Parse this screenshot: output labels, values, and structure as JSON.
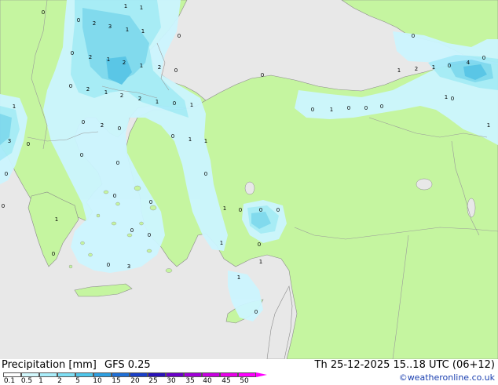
{
  "map": {
    "colors": {
      "sea": "#e8e8e8",
      "land": "#c5f5a0",
      "border": "#9a9a9a",
      "coast": "#8a8a8a",
      "precip_light": "#ccf5ff",
      "precip_mid": "#a6ecfa",
      "precip_heavy": "#7ed9f2",
      "precip_max": "#55c4ea"
    },
    "point_labels": [
      {
        "text": "0"
      },
      {
        "text": "1"
      },
      {
        "text": "1"
      },
      {
        "text": "0"
      },
      {
        "text": "2"
      },
      {
        "text": "3"
      },
      {
        "text": "1"
      },
      {
        "text": "1"
      },
      {
        "text": "0"
      },
      {
        "text": "0"
      },
      {
        "text": "2"
      },
      {
        "text": "1"
      },
      {
        "text": "2"
      },
      {
        "text": "1"
      },
      {
        "text": "2"
      },
      {
        "text": "0"
      },
      {
        "text": "0"
      },
      {
        "text": "2"
      },
      {
        "text": "1"
      },
      {
        "text": "2"
      },
      {
        "text": "2"
      },
      {
        "text": "1"
      },
      {
        "text": "0"
      },
      {
        "text": "1"
      },
      {
        "text": "1"
      },
      {
        "text": "0"
      },
      {
        "text": "2"
      },
      {
        "text": "0"
      },
      {
        "text": "3"
      },
      {
        "text": "0"
      },
      {
        "text": "0"
      },
      {
        "text": "1"
      },
      {
        "text": "1"
      },
      {
        "text": "0"
      },
      {
        "text": "0"
      },
      {
        "text": "0"
      },
      {
        "text": "0"
      },
      {
        "text": "0"
      },
      {
        "text": "0"
      },
      {
        "text": "1"
      },
      {
        "text": "0"
      },
      {
        "text": "0"
      },
      {
        "text": "0"
      },
      {
        "text": "0"
      },
      {
        "text": "1"
      },
      {
        "text": "0"
      },
      {
        "text": "0"
      },
      {
        "text": "1"
      },
      {
        "text": "0"
      },
      {
        "text": "0"
      },
      {
        "text": "0"
      },
      {
        "text": "3"
      },
      {
        "text": "1"
      },
      {
        "text": "1"
      },
      {
        "text": "0"
      },
      {
        "text": "0"
      },
      {
        "text": "0"
      },
      {
        "text": "1"
      },
      {
        "text": "0"
      },
      {
        "text": "0"
      },
      {
        "text": "1"
      },
      {
        "text": "2"
      },
      {
        "text": "1"
      },
      {
        "text": "0"
      },
      {
        "text": "4"
      },
      {
        "text": "0"
      },
      {
        "text": "1"
      },
      {
        "text": "0"
      },
      {
        "text": "0"
      },
      {
        "text": "0"
      },
      {
        "text": "1"
      }
    ]
  },
  "legend": {
    "title": "Precipitation [mm]",
    "model": "GFS 0.25",
    "datetime": "Th 25-12-2025 15..18 UTC (06+12)",
    "credit": "©weatheronline.co.uk",
    "scale_labels": [
      "0.1",
      "0.5",
      "1",
      "2",
      "5",
      "10",
      "15",
      "20",
      "25",
      "30",
      "35",
      "40",
      "45",
      "50"
    ],
    "scale_colors": [
      "#ffffff",
      "#d2f8fd",
      "#aaeefb",
      "#7fdff4",
      "#4fc6ea",
      "#2e9fe0",
      "#1f6fd6",
      "#1a3fc8",
      "#2a12b8",
      "#6a00c8",
      "#a000d8",
      "#c800e0",
      "#e800e8",
      "#ff00ff"
    ]
  }
}
